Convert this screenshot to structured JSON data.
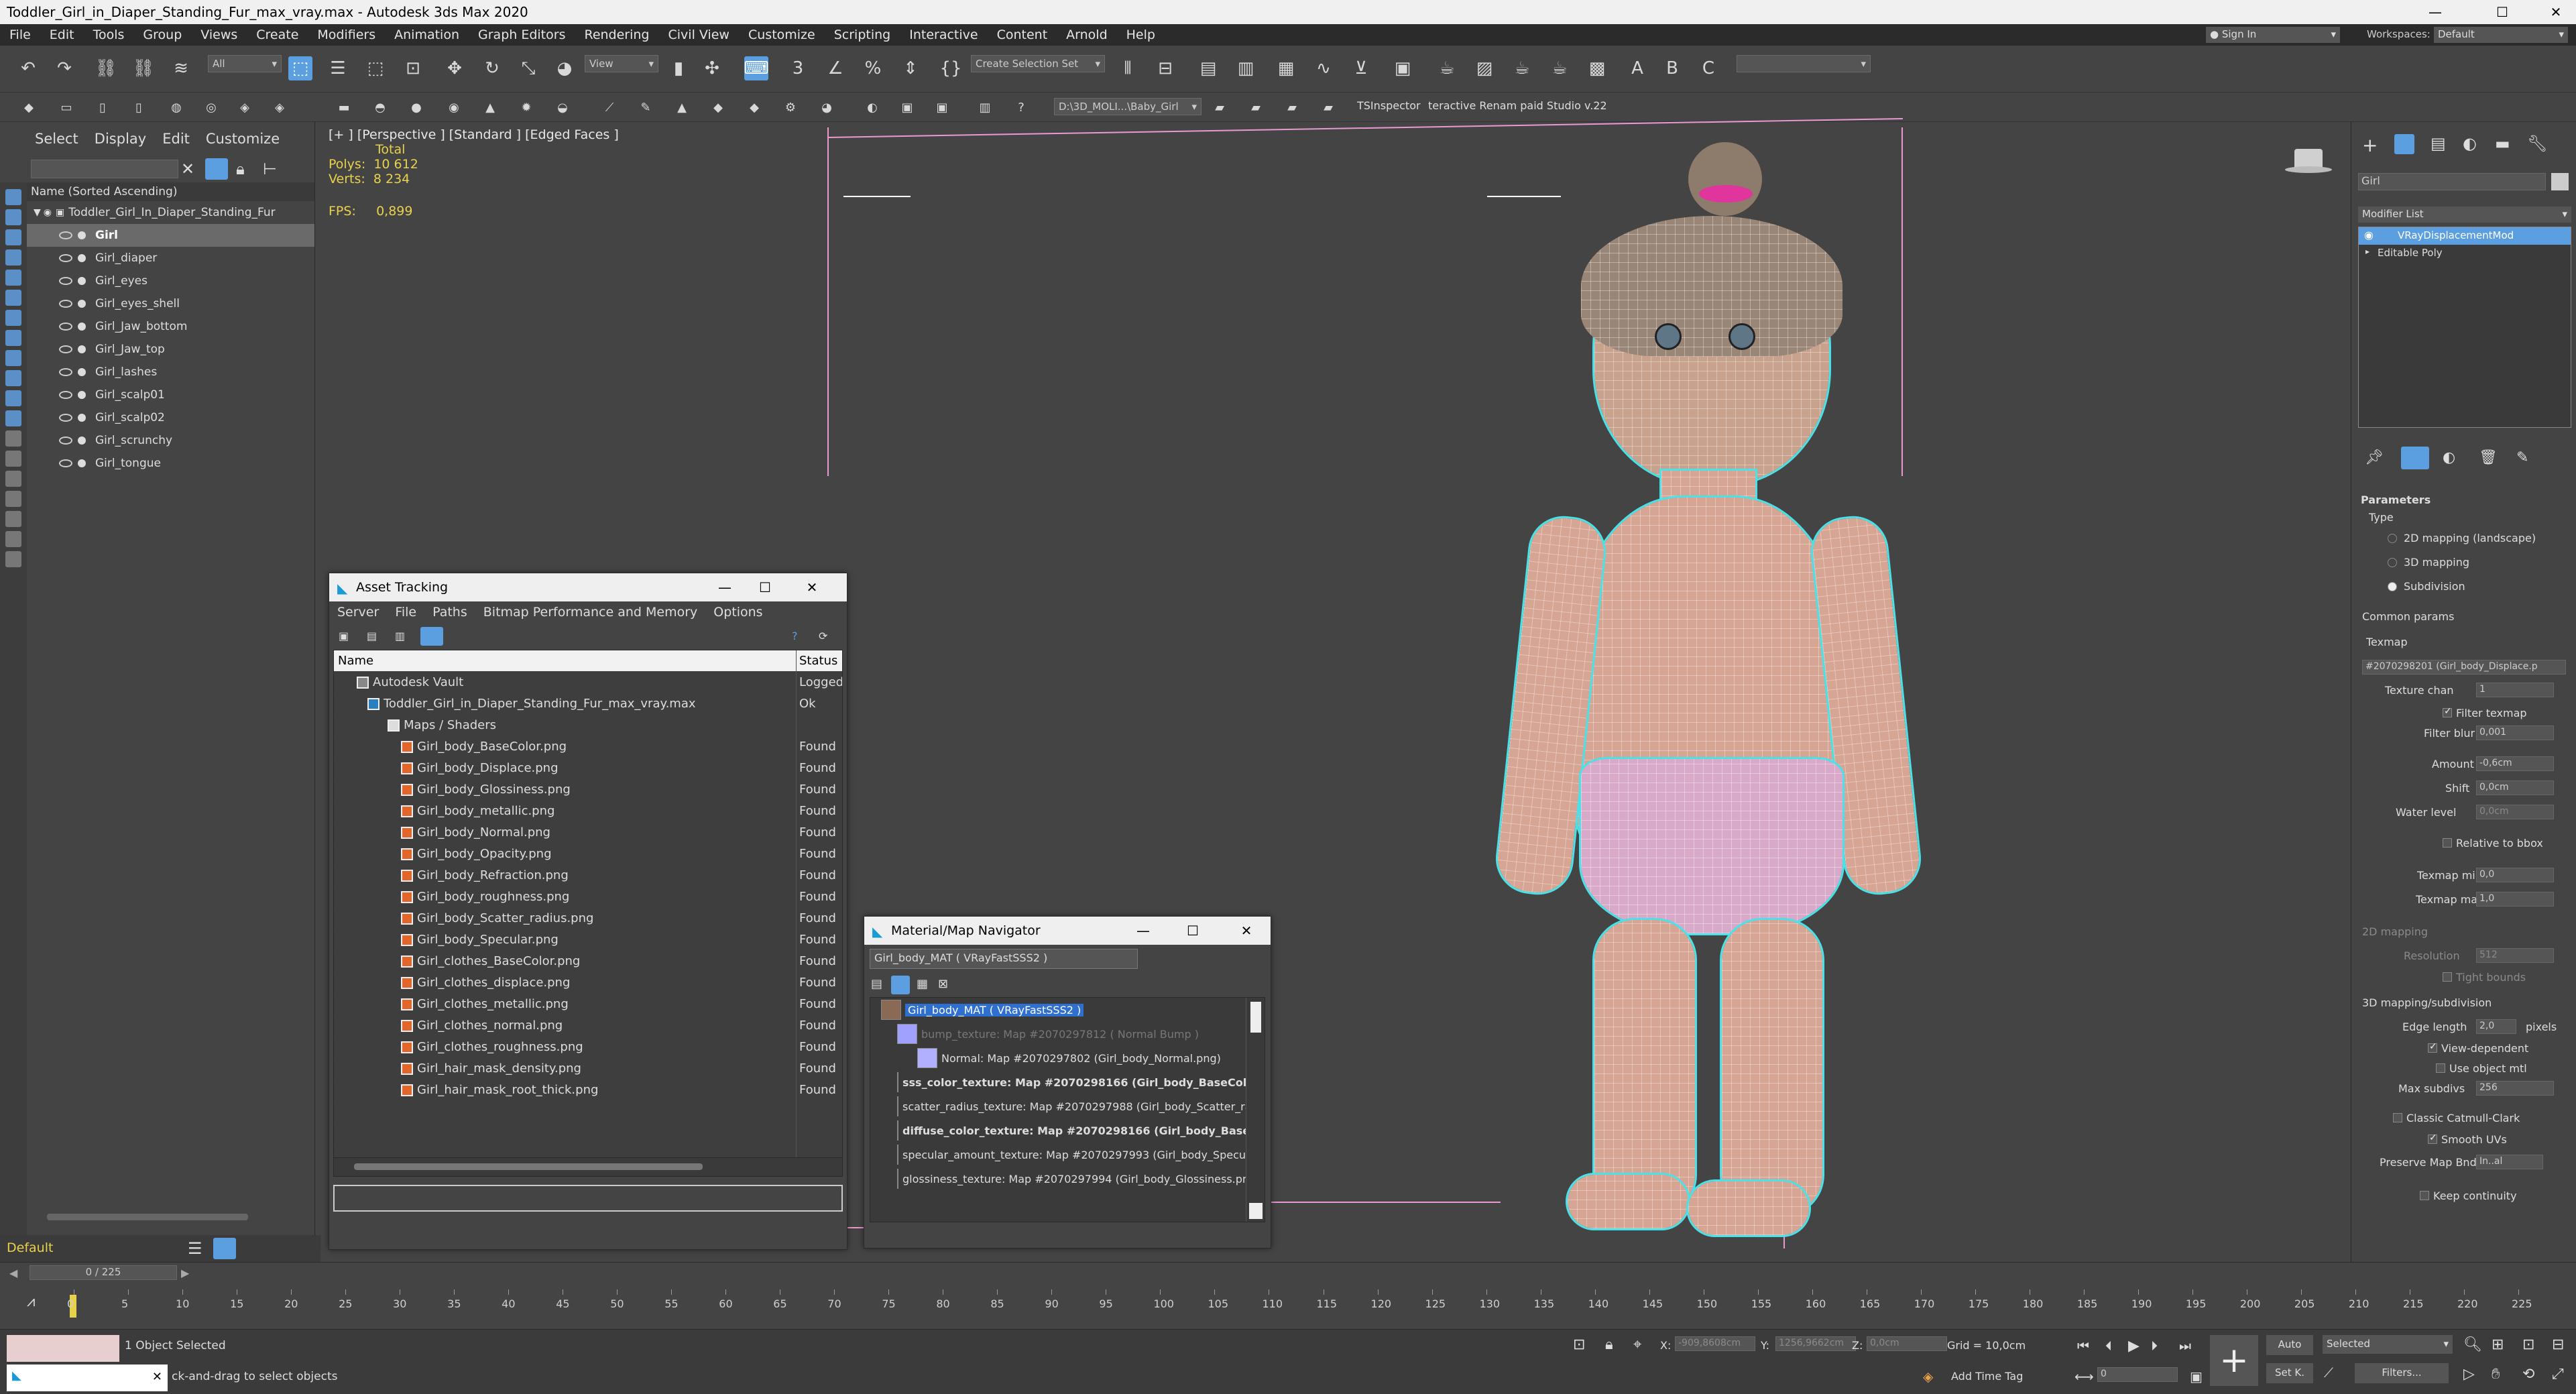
{
  "window": {
    "title": "Toddler_Girl_in_Diaper_Standing_Fur_max_vray.max - Autodesk 3ds Max 2020",
    "min": "—",
    "max": "☐",
    "close": "✕"
  },
  "menu": [
    "File",
    "Edit",
    "Tools",
    "Group",
    "Views",
    "Create",
    "Modifiers",
    "Animation",
    "Graph Editors",
    "Rendering",
    "Civil View",
    "Customize",
    "Scripting",
    "Interactive",
    "Content",
    "Arnold",
    "Help"
  ],
  "account": {
    "signin": "Sign In",
    "workspaces_label": "Workspaces:",
    "workspace": "Default"
  },
  "toolbar": {
    "filter": "All",
    "view": "View",
    "named_selection": "Create Selection Set",
    "path": "D:\\3D_MOLI...\\Baby_Girl",
    "tsinspector": "TSInspector",
    "renamer": "teractive Renam paid Studio v.22"
  },
  "scene": {
    "tabs": [
      "Select",
      "Display",
      "Edit",
      "Customize"
    ],
    "header": "Name (Sorted Ascending)",
    "root": "Toddler_Girl_In_Diaper_Standing_Fur",
    "items": [
      "Girl",
      "Girl_diaper",
      "Girl_eyes",
      "Girl_eyes_shell",
      "Girl_Jaw_bottom",
      "Girl_Jaw_top",
      "Girl_lashes",
      "Girl_scalp01",
      "Girl_scalp02",
      "Girl_scrunchy",
      "Girl_tongue"
    ],
    "layer": "Default"
  },
  "viewport": {
    "label": "[+ ] [Perspective ] [Standard ] [Edged Faces ]",
    "total": "Total",
    "polys_label": "Polys:",
    "polys": "10 612",
    "verts_label": "Verts:",
    "verts": "8 234",
    "fps_label": "FPS:",
    "fps": "0,899"
  },
  "asset": {
    "title": "Asset Tracking",
    "menu": [
      "Server",
      "File",
      "Paths",
      "Bitmap Performance and Memory",
      "Options"
    ],
    "col_name": "Name",
    "col_status": "Status",
    "rows": [
      {
        "name": "Autodesk Vault",
        "status": "Logged O"
      },
      {
        "name": "Toddler_Girl_in_Diaper_Standing_Fur_max_vray.max",
        "status": "Ok"
      },
      {
        "name": "Maps / Shaders",
        "status": ""
      },
      {
        "name": "Girl_body_BaseColor.png",
        "status": "Found"
      },
      {
        "name": "Girl_body_Displace.png",
        "status": "Found"
      },
      {
        "name": "Girl_body_Glossiness.png",
        "status": "Found"
      },
      {
        "name": "Girl_body_metallic.png",
        "status": "Found"
      },
      {
        "name": "Girl_body_Normal.png",
        "status": "Found"
      },
      {
        "name": "Girl_body_Opacity.png",
        "status": "Found"
      },
      {
        "name": "Girl_body_Refraction.png",
        "status": "Found"
      },
      {
        "name": "Girl_body_roughness.png",
        "status": "Found"
      },
      {
        "name": "Girl_body_Scatter_radius.png",
        "status": "Found"
      },
      {
        "name": "Girl_body_Specular.png",
        "status": "Found"
      },
      {
        "name": "Girl_clothes_BaseColor.png",
        "status": "Found"
      },
      {
        "name": "Girl_clothes_displace.png",
        "status": "Found"
      },
      {
        "name": "Girl_clothes_metallic.png",
        "status": "Found"
      },
      {
        "name": "Girl_clothes_normal.png",
        "status": "Found"
      },
      {
        "name": "Girl_clothes_roughness.png",
        "status": "Found"
      },
      {
        "name": "Girl_hair_mask_density.png",
        "status": "Found"
      },
      {
        "name": "Girl_hair_mask_root_thick.png",
        "status": "Found"
      }
    ]
  },
  "matnav": {
    "title": "Material/Map Navigator",
    "current": "Girl_body_MAT ( VRayFastSSS2 )",
    "rows": [
      {
        "text": "Girl_body_MAT ( VRayFastSSS2 )",
        "swatch": "#8a6a55"
      },
      {
        "text": "bump_texture: Map #2070297812 ( Normal Bump )",
        "swatch": "#a0a0ff"
      },
      {
        "text": "Normal: Map #2070297802 (Girl_body_Normal.png)",
        "swatch": "#b0b0ff"
      },
      {
        "text": "sss_color_texture: Map #2070298166 (Girl_body_BaseColo",
        "swatch": "#c05050"
      },
      {
        "text": "scatter_radius_texture: Map #2070297988 (Girl_body_Scatter_radiu",
        "swatch": "#f0f0f0"
      },
      {
        "text": "diffuse_color_texture: Map #2070298166 (Girl_body_BaseC",
        "swatch": "#c05050"
      },
      {
        "text": "specular_amount_texture: Map #2070297993 (Girl_body_Specular.p",
        "swatch": "#777777"
      },
      {
        "text": "glossiness_texture: Map #2070297994 (Girl_body_Glossiness.png)",
        "swatch": "#999999"
      }
    ]
  },
  "modify": {
    "object_name": "Girl",
    "modifier_list": "Modifier List",
    "stack": [
      "VRayDisplacementMod",
      "Editable Poly"
    ],
    "params": {
      "title": "Parameters",
      "type_label": "Type",
      "types": [
        "2D mapping (landscape)",
        "3D mapping",
        "Subdivision"
      ],
      "common": "Common params",
      "texmap_label": "Texmap",
      "texmap": "#2070298201 (Girl_body_Displace.p",
      "texture_chan_label": "Texture chan",
      "texture_chan": "1",
      "filter_texmap": "Filter texmap",
      "filter_blur_label": "Filter blur",
      "filter_blur": "0,001",
      "amount_label": "Amount",
      "amount": "-0,6cm",
      "shift_label": "Shift",
      "shift": "0,0cm",
      "water_label": "Water level",
      "water": "0,0cm",
      "relative": "Relative to bbox",
      "tmin_label": "Texmap min",
      "tmin": "0,0",
      "tmax_label": "Texmap max",
      "tmax": "1,0",
      "map2d": "2D mapping",
      "res_label": "Resolution",
      "res": "512",
      "tight": "Tight bounds",
      "map3d": "3D mapping/subdivision",
      "edge_label": "Edge length",
      "edge": "2,0",
      "pixels": "pixels",
      "viewdep": "View-dependent",
      "useobj": "Use object mtl",
      "maxsub_label": "Max subdivs",
      "maxsub": "256",
      "catmull": "Classic Catmull-Clark",
      "smooth": "Smooth UVs",
      "preserve_label": "Preserve Map Bnd",
      "preserve": "In..al",
      "keep": "Keep continuity"
    }
  },
  "timeline": {
    "frame": "0 / 225",
    "ticks": [
      "0",
      "5",
      "10",
      "15",
      "20",
      "25",
      "30",
      "35",
      "40",
      "45",
      "50",
      "55",
      "60",
      "65",
      "70",
      "75",
      "80",
      "85",
      "90",
      "95",
      "100",
      "105",
      "110",
      "115",
      "120",
      "125",
      "130",
      "135",
      "140",
      "145",
      "150",
      "155",
      "160",
      "165",
      "170",
      "175",
      "180",
      "185",
      "190",
      "195",
      "200",
      "205",
      "210",
      "215",
      "220",
      "225"
    ]
  },
  "status": {
    "selected": "1 Object Selected",
    "prompt": "ck-and-drag to select objects",
    "x_label": "X:",
    "x": "-909,8608cm",
    "y_label": "Y:",
    "y": "1256,9662cm",
    "z_label": "Z:",
    "z": "0,0cm",
    "grid": "Grid = 10,0cm",
    "addtime": "Add Time Tag",
    "auto": "Auto",
    "setkey": "Set K.",
    "selected_dd": "Selected",
    "filters": "Filters...",
    "frame_field": "0"
  }
}
